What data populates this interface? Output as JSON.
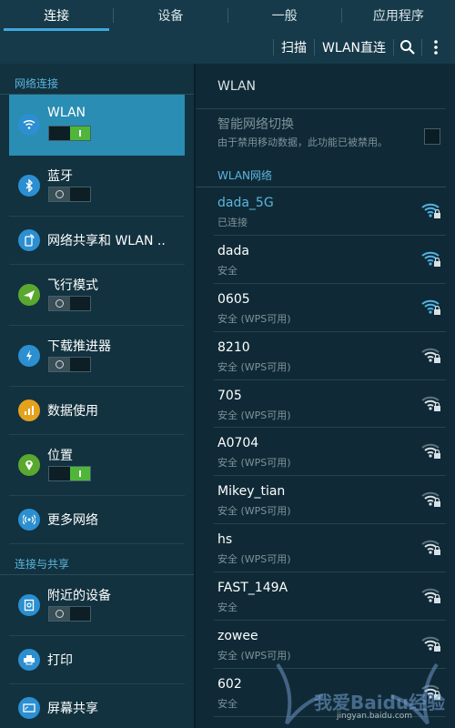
{
  "tabs": [
    {
      "label": "连接",
      "active": true
    },
    {
      "label": "设备",
      "active": false
    },
    {
      "label": "一般",
      "active": false
    },
    {
      "label": "应用程序",
      "active": false
    }
  ],
  "actionbar": {
    "scan": "扫描",
    "direct": "WLAN直连",
    "search_icon": "search-icon",
    "more_icon": "more-vert-icon"
  },
  "left": {
    "section1": "网络连接",
    "section2": "连接与共享",
    "items": [
      {
        "label": "WLAN",
        "icon": "wifi-icon",
        "color": "#2b8fd1",
        "toggle": "on"
      },
      {
        "label": "蓝牙",
        "icon": "bluetooth-icon",
        "color": "#2b8fd1",
        "toggle": "off"
      },
      {
        "label": "网络共享和 WLAN ..",
        "icon": "hotspot-icon",
        "color": "#2b8fd1"
      },
      {
        "label": "飞行模式",
        "icon": "airplane-icon",
        "color": "#5aa82f",
        "toggle": "off"
      },
      {
        "label": "下载推进器",
        "icon": "download-booster-icon",
        "color": "#2b8fd1",
        "toggle": "off"
      },
      {
        "label": "数据使用",
        "icon": "data-usage-icon",
        "color": "#e3a21e"
      },
      {
        "label": "位置",
        "icon": "location-icon",
        "color": "#5aa82f",
        "toggle": "on"
      },
      {
        "label": "更多网络",
        "icon": "more-networks-icon",
        "color": "#2b8fd1"
      },
      {
        "label": "附近的设备",
        "icon": "nearby-device-icon",
        "color": "#2b8fd1",
        "toggle": "off"
      },
      {
        "label": "打印",
        "icon": "print-icon",
        "color": "#2b8fd1"
      },
      {
        "label": "屏幕共享",
        "icon": "screen-share-icon",
        "color": "#2b8fd1"
      }
    ]
  },
  "right": {
    "header": "WLAN",
    "smart_title": "智能网络切换",
    "smart_desc": "由于禁用移动数据，此功能已被禁用。",
    "section": "WLAN网络",
    "networks": [
      {
        "name": "dada_5G",
        "status": "已连接",
        "connected": true,
        "strength": 4
      },
      {
        "name": "dada",
        "status": "安全",
        "strength": 4
      },
      {
        "name": "0605",
        "status": "安全 (WPS可用)",
        "strength": 4
      },
      {
        "name": "8210",
        "status": "安全 (WPS可用)",
        "strength": 3
      },
      {
        "name": "705",
        "status": "安全 (WPS可用)",
        "strength": 3
      },
      {
        "name": "A0704",
        "status": "安全 (WPS可用)",
        "strength": 3
      },
      {
        "name": "Mikey_tian",
        "status": "安全 (WPS可用)",
        "strength": 3
      },
      {
        "name": "hs",
        "status": "安全 (WPS可用)",
        "strength": 3
      },
      {
        "name": "FAST_149A",
        "status": "安全",
        "strength": 3
      },
      {
        "name": "zowee",
        "status": "安全 (WPS可用)",
        "strength": 3
      },
      {
        "name": "602",
        "status": "安全",
        "strength": 3
      }
    ]
  },
  "watermark": {
    "text": "我爱Baidu经验",
    "url": "jingyan.baidu.com"
  },
  "colors": {
    "accent": "#3fa9dd",
    "selected": "#2a8db3",
    "toggle_on": "#4fb63a"
  }
}
